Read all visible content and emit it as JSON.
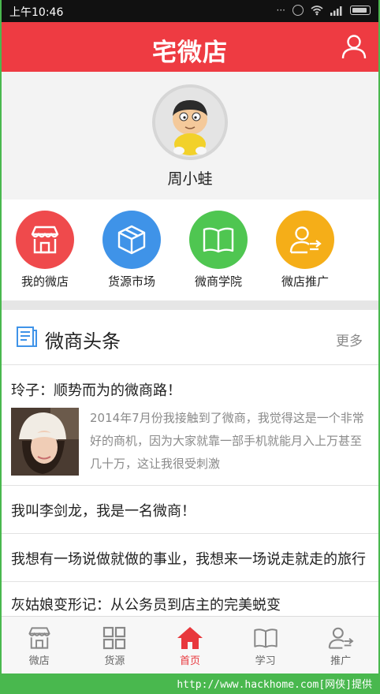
{
  "status_bar": {
    "time": "上午10:46"
  },
  "header": {
    "title": "宅微店"
  },
  "profile": {
    "name": "周小蛙"
  },
  "quick_menu": [
    {
      "label": "我的微店",
      "color": "#ef4a4c",
      "icon": "shop-icon"
    },
    {
      "label": "货源市场",
      "color": "#3f93e8",
      "icon": "box-icon"
    },
    {
      "label": "微商学院",
      "color": "#4fc651",
      "icon": "book-icon"
    },
    {
      "label": "微店推广",
      "color": "#f5ae18",
      "icon": "promote-user-icon"
    }
  ],
  "news": {
    "title": "微商头条",
    "more": "更多",
    "articles": [
      {
        "title": "玲子：顺势而为的微商路！",
        "excerpt": "2014年7月份我接触到了微商，我觉得这是一个非常好的商机，因为大家就靠一部手机就能月入上万甚至几十万，这让我很受刺激"
      },
      {
        "title": "我叫李剑龙，我是一名微商！"
      },
      {
        "title": "我想有一场说做就做的事业，我想来一场说走就走的旅行"
      },
      {
        "title": "灰姑娘变形记：从公务员到店主的完美蜕变"
      }
    ]
  },
  "tabs": [
    {
      "label": "微店",
      "icon": "shop-icon"
    },
    {
      "label": "货源",
      "icon": "grid-icon"
    },
    {
      "label": "首页",
      "icon": "home-icon",
      "active": true
    },
    {
      "label": "学习",
      "icon": "book-icon"
    },
    {
      "label": "推广",
      "icon": "promote-user-icon"
    }
  ],
  "footer": {
    "credit": "http://www.hackhome.com[网侠]提供"
  },
  "colors": {
    "brand_red": "#ee3b42",
    "frame_green": "#49b84e"
  }
}
